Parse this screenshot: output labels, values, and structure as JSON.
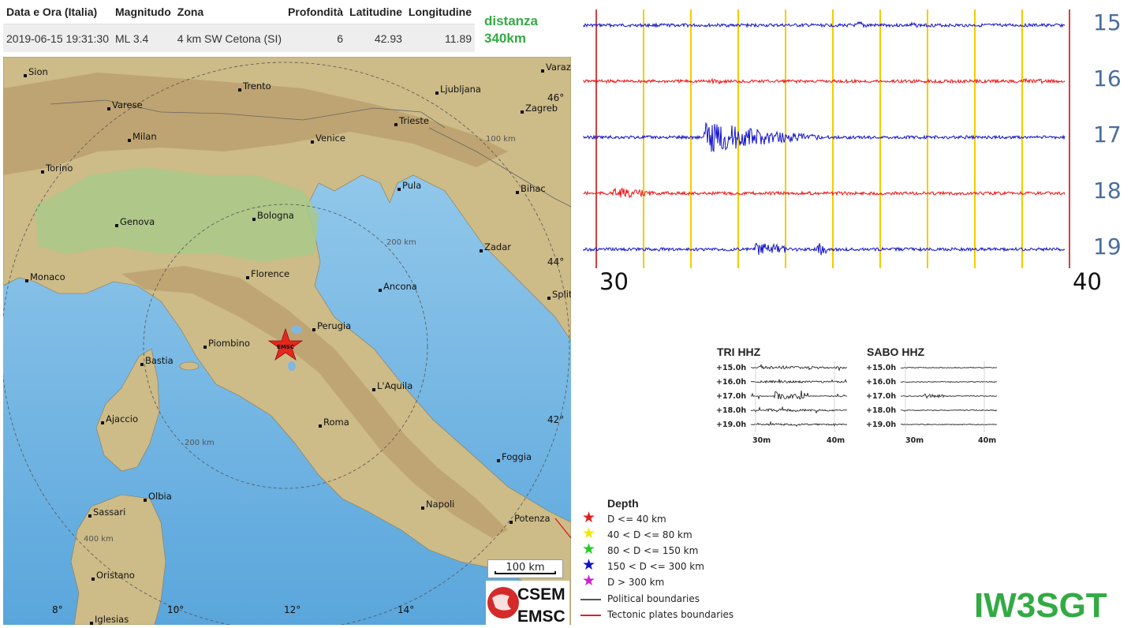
{
  "event_table": {
    "headers": [
      "Data e Ora (Italia)",
      "Magnitudo",
      "Zona",
      "Profondità",
      "Latitudine",
      "Longitudine"
    ],
    "row": [
      "2019-06-15 19:31:30",
      "ML 3.4",
      "4 km SW Cetona (SI)",
      "6",
      "42.93",
      "11.89"
    ]
  },
  "distance": {
    "line1": "distanza",
    "line2": "340km"
  },
  "map": {
    "cities": [
      "Sion",
      "Varese",
      "Trento",
      "Ljubljana",
      "Zagreb",
      "Varaz",
      "Milan",
      "Venice",
      "Trieste",
      "Torino",
      "Pula",
      "Bihac",
      "Genova",
      "Bologna",
      "Zadar",
      "Florence",
      "Monaco",
      "Ancona",
      "Split",
      "Perugia",
      "Piombino",
      "Bastia",
      "L'Aquila",
      "Ajaccio",
      "Roma",
      "Foggia",
      "Olbia",
      "Sassari",
      "Napoli",
      "Potenza",
      "Oristano",
      "Iglesias"
    ],
    "rings": [
      "100 km",
      "200 km",
      "200 km",
      "400 km"
    ],
    "lat_labels": [
      "46°",
      "44°",
      "42°"
    ],
    "lon_labels": [
      "8°",
      "10°",
      "12°",
      "14°"
    ],
    "epicenter_label": "EMSC",
    "scale_label": "100 km",
    "logo": [
      "CSEM",
      "EMSC"
    ]
  },
  "helicorder": {
    "row_numbers": [
      "15",
      "16",
      "17",
      "18",
      "19"
    ],
    "row_colors": [
      "#1010cc",
      "#ee1111",
      "#1010cc",
      "#ee1111",
      "#1010cc"
    ],
    "marker_color": "#f2cc00",
    "start_label": "30",
    "end_label": "40"
  },
  "stations": [
    {
      "title": "TRI HHZ",
      "rows": [
        "+15.0h",
        "+16.0h",
        "+17.0h",
        "+18.0h",
        "+19.0h"
      ],
      "ticks": [
        "30m",
        "40m"
      ]
    },
    {
      "title": "SABO HHZ",
      "rows": [
        "+15.0h",
        "+16.0h",
        "+17.0h",
        "+18.0h",
        "+19.0h"
      ],
      "ticks": [
        "30m",
        "40m"
      ]
    }
  ],
  "legend": {
    "title": "Depth",
    "items": [
      {
        "label": "D <= 40 km",
        "color": "#e02020",
        "icon": "star-icon"
      },
      {
        "label": "40 < D <= 80 km",
        "color": "#f5e600",
        "icon": "star-icon"
      },
      {
        "label": "80 < D <= 150 km",
        "color": "#22cc22",
        "icon": "star-icon"
      },
      {
        "label": "150 < D <= 300 km",
        "color": "#1010cc",
        "icon": "star-icon"
      },
      {
        "label": "D > 300 km",
        "color": "#cc22cc",
        "icon": "star-icon"
      }
    ],
    "lines": [
      {
        "label": "Political boundaries",
        "color": "#555555"
      },
      {
        "label": "Tectonic plates boundaries",
        "color": "#dd2222"
      }
    ]
  },
  "callsign": "IW3SGT"
}
